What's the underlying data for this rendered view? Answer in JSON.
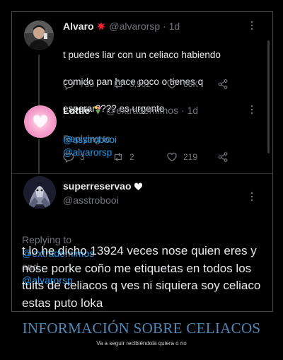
{
  "tweets": [
    {
      "name": "Alvaro",
      "handle": "@alvarorsp",
      "time": "· 1d",
      "text_lines": [
        "t puedes liar con un celiaco habiendo",
        "comido pan hace poco o tienes q",
        "esperar???? es urgente"
      ],
      "replies": "730",
      "retweets": "3,902",
      "likes": "66K"
    },
    {
      "name": "Lottie",
      "handle": "@extrademimos",
      "time": "· 1d",
      "replying_prefix": "Replying to",
      "replying_to": "@alvarorsp",
      "text": "@asstrobooi",
      "replies": "3",
      "retweets": "2",
      "likes": "219"
    }
  ],
  "main_tweet": {
    "name": "superreservao",
    "handle": "@asstrobooi",
    "replying_prefix": "Replying to",
    "replying_to_1": "@extrademimos",
    "replying_and": "and",
    "replying_to_2": "@alvarorsp",
    "text": "t lo he dicho 13924 veces nose quien eres y nose porke coño me etiquetas en todos los tuits de celiacos q ves ni siquiera soy celiaco estas puto loka"
  },
  "caption": {
    "title": "INFORMACIÓN SOBRE CELIACOS",
    "subtitle": "Va a seguir recibiéndola quiera o no"
  },
  "icons": [
    "reply-icon",
    "retweet-icon",
    "like-icon",
    "share-icon",
    "more-icon"
  ],
  "colors": {
    "accent": "#1d9bf0",
    "caption": "#4d87b6",
    "muted": "#71767b"
  }
}
